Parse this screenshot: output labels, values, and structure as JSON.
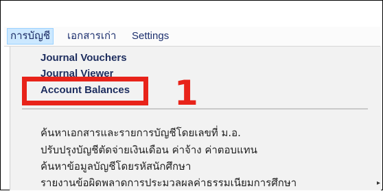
{
  "menubar": {
    "items": [
      {
        "label": "การบัญชี",
        "active": true
      },
      {
        "label": "เอกสารเก่า",
        "active": false
      },
      {
        "label": "Settings",
        "active": false
      }
    ]
  },
  "dropdown": {
    "items": [
      {
        "label": "Journal Vouchers"
      },
      {
        "label": "Journal Viewer"
      },
      {
        "label": "Account Balances"
      },
      {
        "label": "ค้นหาเอกสารและรายการบัญชีโดยเลขที่ ม.อ."
      },
      {
        "label": "ปรับปรุงบัญชีตัดจ่ายเงินเดือน ค่าจ้าง ค่าตอบแทน"
      },
      {
        "label": "ค้นหาข้อมูลบัญชีโดยรหัสนักศึกษา"
      },
      {
        "label": "รายงานข้อผิดพลาดการประมวลผลค่าธรรมเนียมการศึกษา"
      }
    ],
    "submenu_arrow": "▸"
  },
  "annotation": {
    "step_number": "1",
    "color": "#e8231a"
  }
}
